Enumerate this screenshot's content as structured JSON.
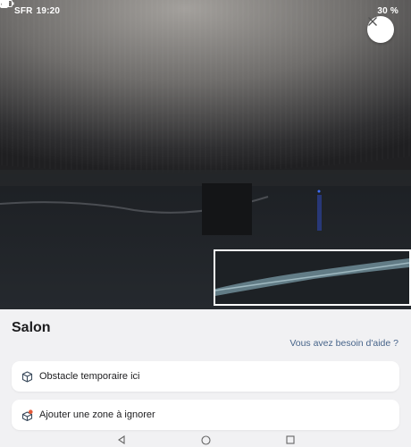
{
  "status_bar": {
    "carrier": "SFR",
    "time": "19:20",
    "battery_percent": "30 %",
    "left_icons": [
      "nfc-icon",
      "whatsapp-icon",
      "x-icon",
      "gmail-icon"
    ],
    "right_icons": [
      "vibrate-icon",
      "mute-icon",
      "wifi-icon",
      "signal-icon",
      "battery-icon"
    ],
    "battery_level": 0.3
  },
  "camera_view": {
    "close_icon": "close-icon"
  },
  "sheet": {
    "room_name": "Salon",
    "help_link": "Vous avez besoin d'aide ?",
    "actions": [
      {
        "label": "Obstacle temporaire ici",
        "icon": "cube-icon"
      },
      {
        "label": "Ajouter une zone à ignorer",
        "icon": "no-go-zone-icon"
      }
    ]
  },
  "nav_bar": {
    "buttons": [
      "back-icon",
      "home-icon",
      "recents-icon"
    ]
  },
  "colors": {
    "accent_link": "#47648a",
    "sheet_background": "#f1f1f3",
    "card_background": "#ffffff"
  }
}
